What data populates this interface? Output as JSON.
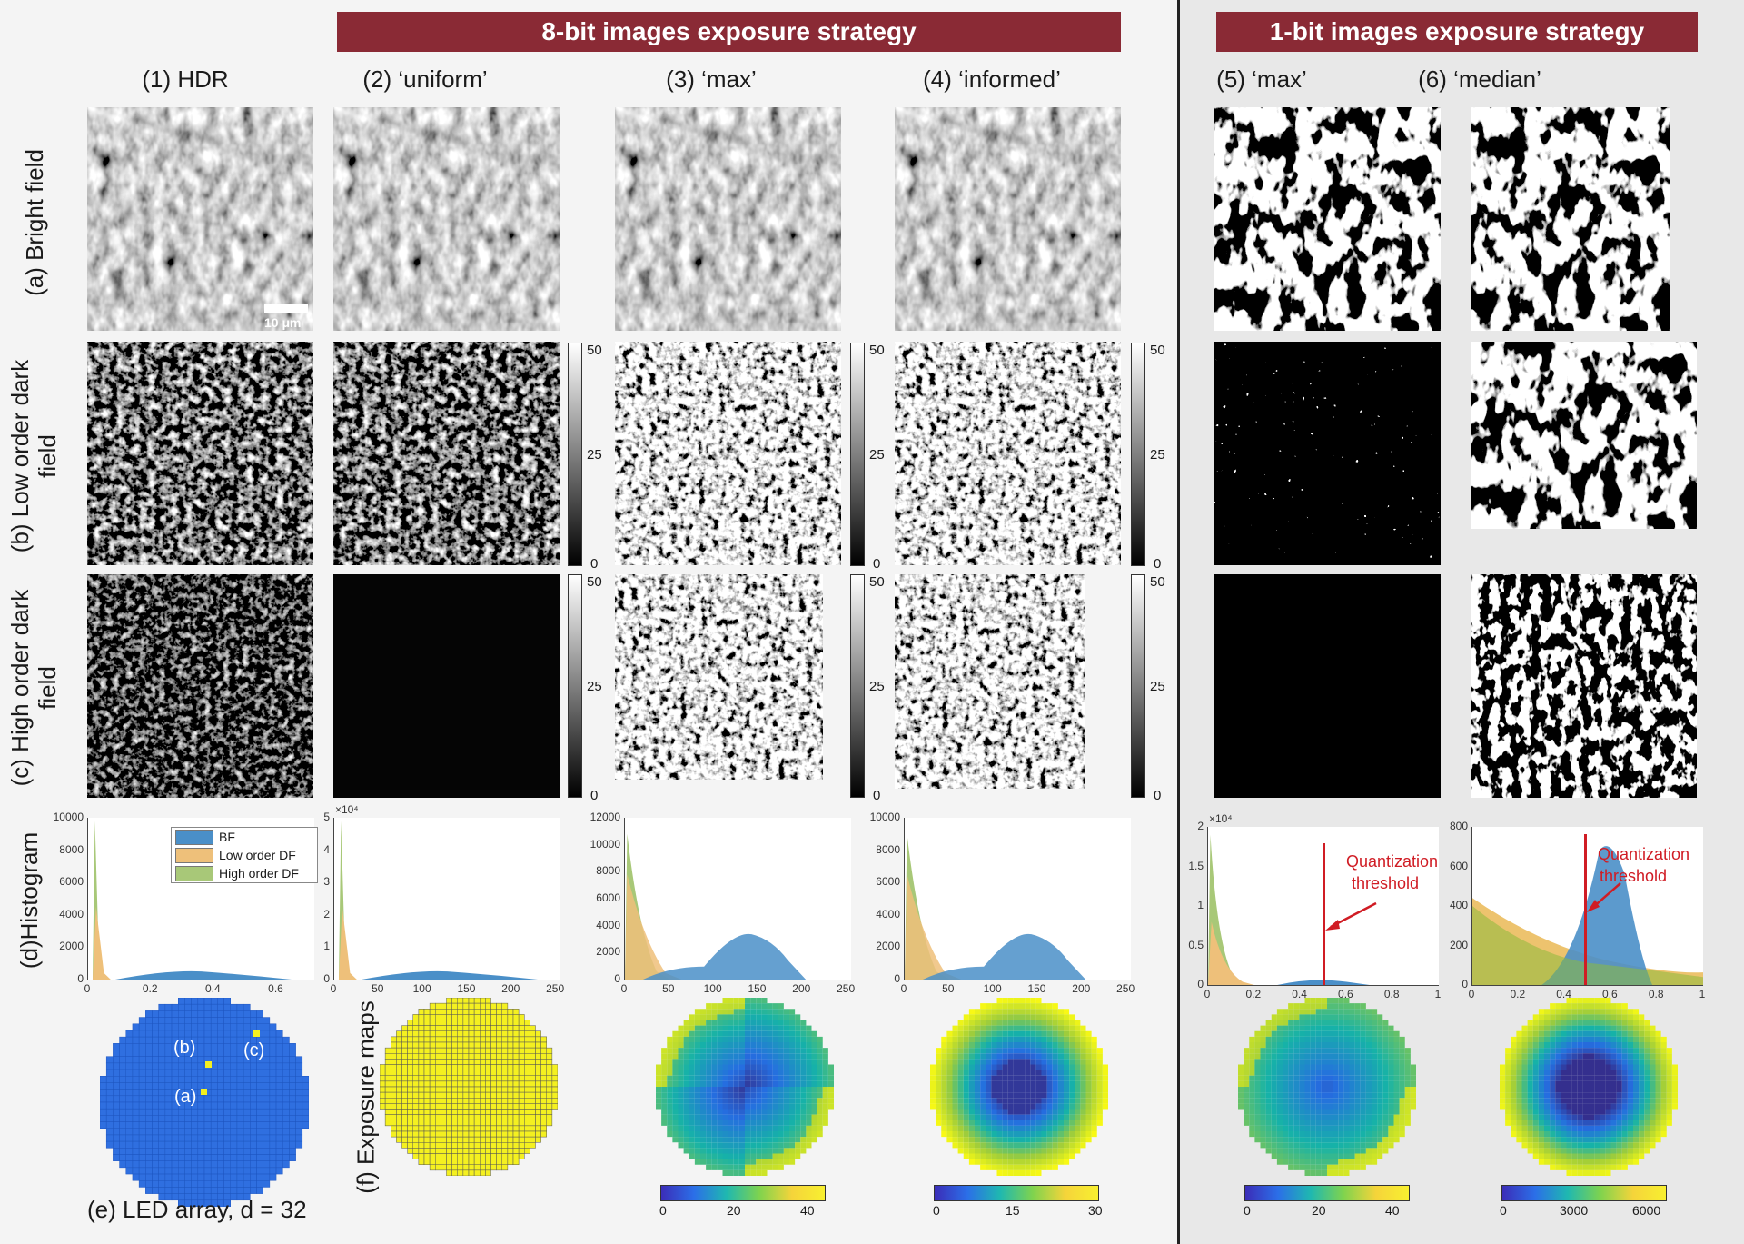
{
  "banners": {
    "eight_bit": "8-bit images exposure strategy",
    "one_bit": "1-bit images exposure strategy"
  },
  "columns": [
    "(1) HDR",
    "(2) ‘uniform’",
    "(3) ‘max’",
    "(4) ‘informed’",
    "(5) ‘max’",
    "(6) ‘median’"
  ],
  "rows": {
    "bright": "(a) Bright field",
    "low_dark_1": "(b) Low order dark",
    "low_dark_2": "field",
    "high_dark_1": "(c) High order dark",
    "high_dark_2": "field",
    "histogram": "(d)Histogram"
  },
  "scale_bar": "10 μm",
  "colorbar_ticks": [
    "50",
    "25",
    "0"
  ],
  "legend": {
    "bf": "BF",
    "low": "Low order DF",
    "high": "High order DF"
  },
  "histograms": [
    {
      "y_ticks": [
        "10000",
        "8000",
        "6000",
        "4000",
        "2000",
        "0"
      ],
      "x_ticks": [
        "0",
        "0.2",
        "0.4",
        "0.6"
      ],
      "exp": ""
    },
    {
      "y_ticks": [
        "5",
        "4",
        "3",
        "2",
        "1",
        "0"
      ],
      "x_ticks": [
        "0",
        "50",
        "100",
        "150",
        "200",
        "250"
      ],
      "exp": "×10⁴"
    },
    {
      "y_ticks": [
        "12000",
        "10000",
        "8000",
        "6000",
        "4000",
        "2000",
        "0"
      ],
      "x_ticks": [
        "0",
        "50",
        "100",
        "150",
        "200",
        "250"
      ],
      "exp": ""
    },
    {
      "y_ticks": [
        "10000",
        "8000",
        "6000",
        "4000",
        "2000",
        "0"
      ],
      "x_ticks": [
        "0",
        "50",
        "100",
        "150",
        "200",
        "250"
      ],
      "exp": ""
    },
    {
      "y_ticks": [
        "2",
        "1.5",
        "1",
        "0.5",
        "0"
      ],
      "x_ticks": [
        "0",
        "0.2",
        "0.4",
        "0.6",
        "0.8",
        "1"
      ],
      "exp": "×10⁴"
    },
    {
      "y_ticks": [
        "800",
        "600",
        "400",
        "200",
        "0"
      ],
      "x_ticks": [
        "0",
        "0.2",
        "0.4",
        "0.6",
        "0.8",
        "1"
      ],
      "exp": ""
    }
  ],
  "threshold_label_1": "Quantization",
  "threshold_label_2": "threshold",
  "led_markers": [
    "(b)",
    "(c)",
    "(a)"
  ],
  "bottom": {
    "led_array": "(e) LED array, d = 32",
    "exposure_maps": "(f) Exposure maps"
  },
  "exposure_colorbars": [
    {
      "ticks": [
        "0",
        "20",
        "40"
      ]
    },
    {
      "ticks": [
        "0",
        "15",
        "30"
      ]
    },
    {
      "ticks": [
        "0",
        "20",
        "40"
      ]
    },
    {
      "ticks": [
        "0",
        "3000",
        "6000"
      ]
    }
  ],
  "colors": {
    "banner": "#8a2a35",
    "bf": "#4a8fc8",
    "low_df": "#e8b44a",
    "high_df": "#8cba3c",
    "threshold": "#d01c24",
    "led_blue": "#2f6fe0",
    "led_yellow": "#f4f020"
  }
}
